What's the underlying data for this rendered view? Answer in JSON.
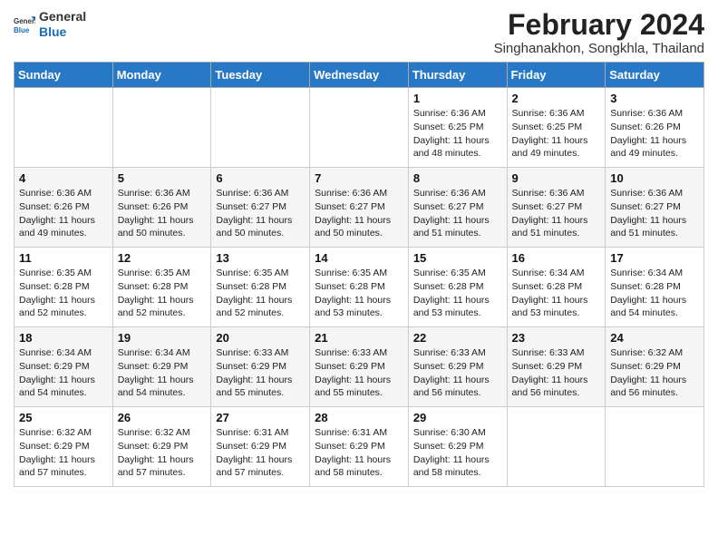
{
  "logo": {
    "line1": "General",
    "line2": "Blue"
  },
  "title": "February 2024",
  "subtitle": "Singhanakhon, Songkhla, Thailand",
  "days_header": [
    "Sunday",
    "Monday",
    "Tuesday",
    "Wednesday",
    "Thursday",
    "Friday",
    "Saturday"
  ],
  "weeks": [
    [
      {
        "num": "",
        "info": ""
      },
      {
        "num": "",
        "info": ""
      },
      {
        "num": "",
        "info": ""
      },
      {
        "num": "",
        "info": ""
      },
      {
        "num": "1",
        "info": "Sunrise: 6:36 AM\nSunset: 6:25 PM\nDaylight: 11 hours\nand 48 minutes."
      },
      {
        "num": "2",
        "info": "Sunrise: 6:36 AM\nSunset: 6:25 PM\nDaylight: 11 hours\nand 49 minutes."
      },
      {
        "num": "3",
        "info": "Sunrise: 6:36 AM\nSunset: 6:26 PM\nDaylight: 11 hours\nand 49 minutes."
      }
    ],
    [
      {
        "num": "4",
        "info": "Sunrise: 6:36 AM\nSunset: 6:26 PM\nDaylight: 11 hours\nand 49 minutes."
      },
      {
        "num": "5",
        "info": "Sunrise: 6:36 AM\nSunset: 6:26 PM\nDaylight: 11 hours\nand 50 minutes."
      },
      {
        "num": "6",
        "info": "Sunrise: 6:36 AM\nSunset: 6:27 PM\nDaylight: 11 hours\nand 50 minutes."
      },
      {
        "num": "7",
        "info": "Sunrise: 6:36 AM\nSunset: 6:27 PM\nDaylight: 11 hours\nand 50 minutes."
      },
      {
        "num": "8",
        "info": "Sunrise: 6:36 AM\nSunset: 6:27 PM\nDaylight: 11 hours\nand 51 minutes."
      },
      {
        "num": "9",
        "info": "Sunrise: 6:36 AM\nSunset: 6:27 PM\nDaylight: 11 hours\nand 51 minutes."
      },
      {
        "num": "10",
        "info": "Sunrise: 6:36 AM\nSunset: 6:27 PM\nDaylight: 11 hours\nand 51 minutes."
      }
    ],
    [
      {
        "num": "11",
        "info": "Sunrise: 6:35 AM\nSunset: 6:28 PM\nDaylight: 11 hours\nand 52 minutes."
      },
      {
        "num": "12",
        "info": "Sunrise: 6:35 AM\nSunset: 6:28 PM\nDaylight: 11 hours\nand 52 minutes."
      },
      {
        "num": "13",
        "info": "Sunrise: 6:35 AM\nSunset: 6:28 PM\nDaylight: 11 hours\nand 52 minutes."
      },
      {
        "num": "14",
        "info": "Sunrise: 6:35 AM\nSunset: 6:28 PM\nDaylight: 11 hours\nand 53 minutes."
      },
      {
        "num": "15",
        "info": "Sunrise: 6:35 AM\nSunset: 6:28 PM\nDaylight: 11 hours\nand 53 minutes."
      },
      {
        "num": "16",
        "info": "Sunrise: 6:34 AM\nSunset: 6:28 PM\nDaylight: 11 hours\nand 53 minutes."
      },
      {
        "num": "17",
        "info": "Sunrise: 6:34 AM\nSunset: 6:28 PM\nDaylight: 11 hours\nand 54 minutes."
      }
    ],
    [
      {
        "num": "18",
        "info": "Sunrise: 6:34 AM\nSunset: 6:29 PM\nDaylight: 11 hours\nand 54 minutes."
      },
      {
        "num": "19",
        "info": "Sunrise: 6:34 AM\nSunset: 6:29 PM\nDaylight: 11 hours\nand 54 minutes."
      },
      {
        "num": "20",
        "info": "Sunrise: 6:33 AM\nSunset: 6:29 PM\nDaylight: 11 hours\nand 55 minutes."
      },
      {
        "num": "21",
        "info": "Sunrise: 6:33 AM\nSunset: 6:29 PM\nDaylight: 11 hours\nand 55 minutes."
      },
      {
        "num": "22",
        "info": "Sunrise: 6:33 AM\nSunset: 6:29 PM\nDaylight: 11 hours\nand 56 minutes."
      },
      {
        "num": "23",
        "info": "Sunrise: 6:33 AM\nSunset: 6:29 PM\nDaylight: 11 hours\nand 56 minutes."
      },
      {
        "num": "24",
        "info": "Sunrise: 6:32 AM\nSunset: 6:29 PM\nDaylight: 11 hours\nand 56 minutes."
      }
    ],
    [
      {
        "num": "25",
        "info": "Sunrise: 6:32 AM\nSunset: 6:29 PM\nDaylight: 11 hours\nand 57 minutes."
      },
      {
        "num": "26",
        "info": "Sunrise: 6:32 AM\nSunset: 6:29 PM\nDaylight: 11 hours\nand 57 minutes."
      },
      {
        "num": "27",
        "info": "Sunrise: 6:31 AM\nSunset: 6:29 PM\nDaylight: 11 hours\nand 57 minutes."
      },
      {
        "num": "28",
        "info": "Sunrise: 6:31 AM\nSunset: 6:29 PM\nDaylight: 11 hours\nand 58 minutes."
      },
      {
        "num": "29",
        "info": "Sunrise: 6:30 AM\nSunset: 6:29 PM\nDaylight: 11 hours\nand 58 minutes."
      },
      {
        "num": "",
        "info": ""
      },
      {
        "num": "",
        "info": ""
      }
    ]
  ]
}
